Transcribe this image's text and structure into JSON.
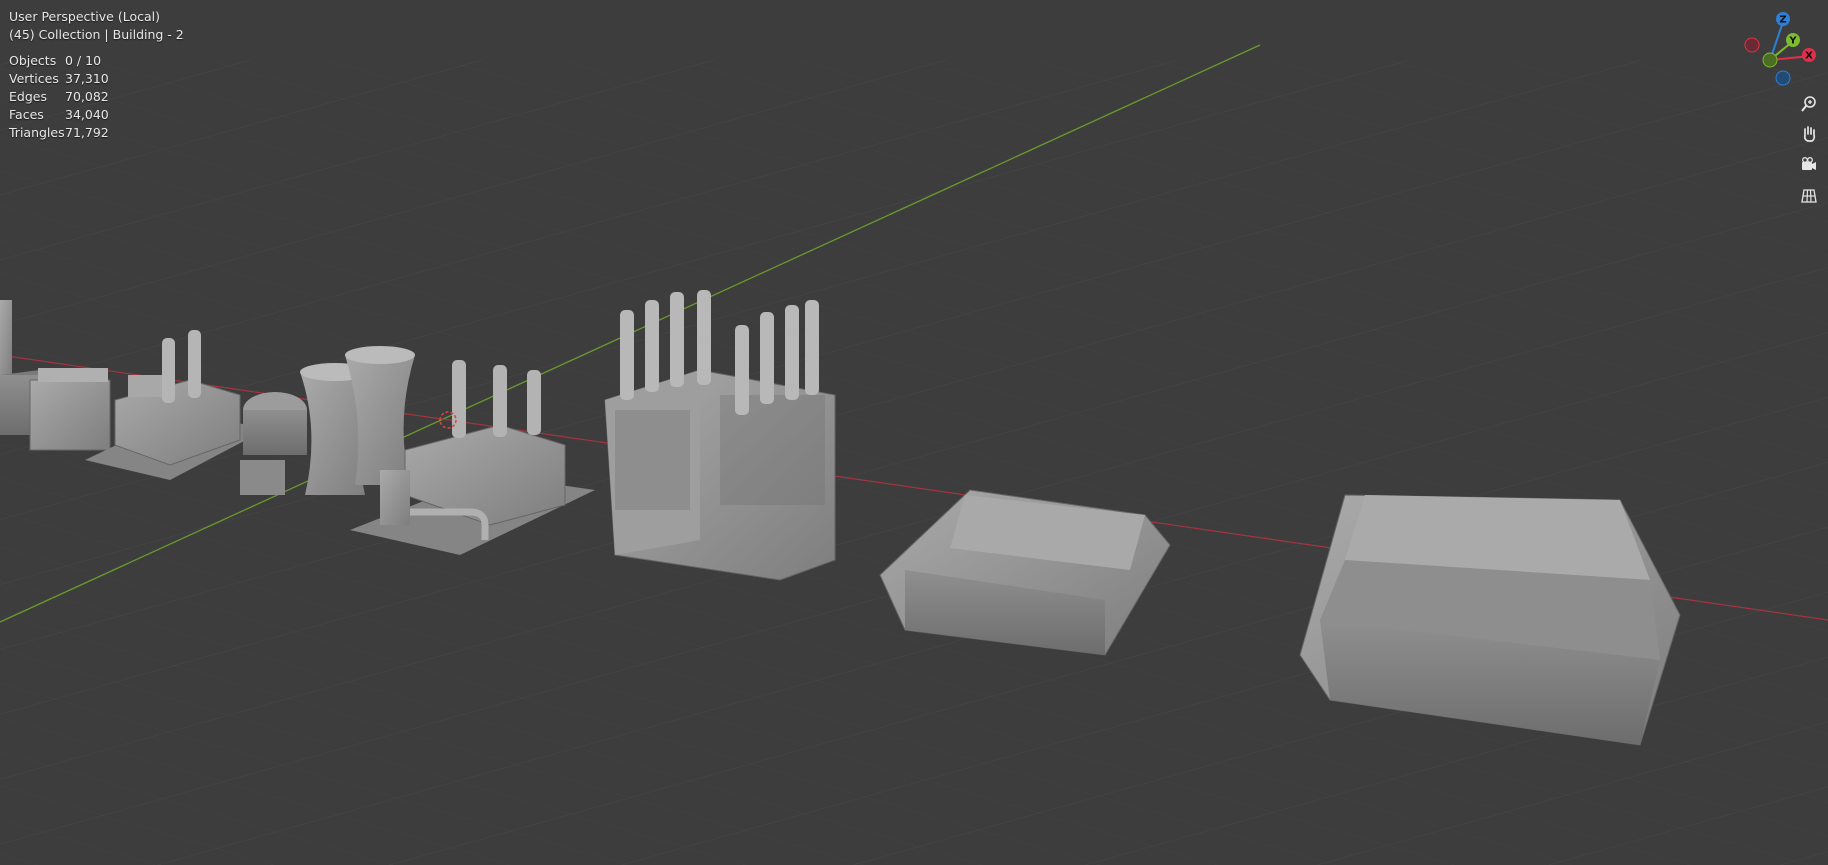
{
  "viewport": {
    "view_name": "User Perspective (Local)",
    "collection_line": "(45) Collection | Building - 2",
    "stats": [
      {
        "label": "Objects",
        "value": "0 / 10"
      },
      {
        "label": "Vertices",
        "value": "37,310"
      },
      {
        "label": "Edges",
        "value": "70,082"
      },
      {
        "label": "Faces",
        "value": "34,040"
      },
      {
        "label": "Triangles",
        "value": "71,792"
      }
    ]
  },
  "gizmo": {
    "axes": [
      {
        "name": "Z",
        "color": "#2f7fd8"
      },
      {
        "name": "Y",
        "color": "#7dbb2f"
      },
      {
        "name": "X",
        "color": "#e0304a"
      }
    ]
  },
  "nav_icons": [
    "zoom-icon",
    "hand-pan-icon",
    "camera-icon",
    "grid-ortho-icon"
  ],
  "colors": {
    "background": "#3d3d3d",
    "grid": "#484848",
    "x_axis": "#a5343f",
    "y_axis": "#6b9a2e",
    "model": "#9a9a9a"
  }
}
